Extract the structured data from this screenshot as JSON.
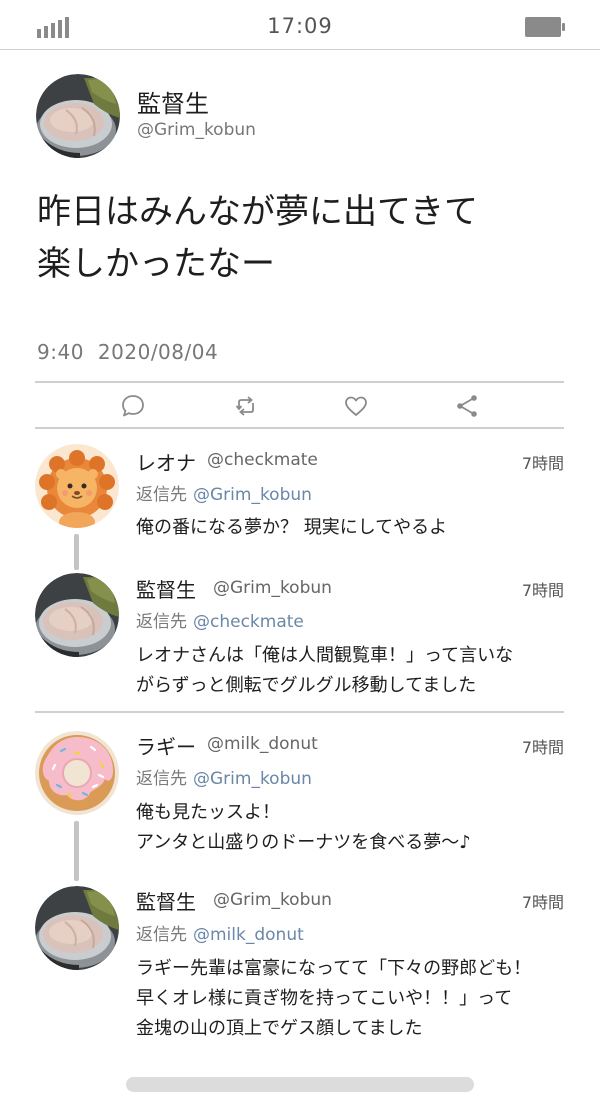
{
  "status_bar": {
    "time": "17:09",
    "signal_icon": "signal-bars-icon",
    "battery_icon": "battery-icon"
  },
  "main_tweet": {
    "display_name": "監督生",
    "handle": "@Grim_kobun",
    "text": "昨日はみんなが夢に出てきて\n楽しかったなー",
    "time": "9:40",
    "date": "2020/08/04",
    "actions": [
      "reply-icon",
      "retweet-icon",
      "like-icon",
      "share-icon"
    ]
  },
  "replies": [
    {
      "display_name": "レオナ",
      "handle": "@checkmate",
      "when": "7時間",
      "reply_prefix": "返信先",
      "reply_to": "@Grim_kobun",
      "text": "俺の番になる夢か？ 現実にしてやるよ",
      "avatar": "lion-avatar"
    },
    {
      "display_name": "監督生",
      "handle": "@Grim_kobun",
      "when": "7時間",
      "reply_prefix": "返信先",
      "reply_to": "@checkmate",
      "text": "レオナさんは「俺は人間観覧車！」って言いな\nがらずっと側転でグルグル移動してました",
      "avatar": "tuna-can-avatar"
    },
    {
      "display_name": "ラギー",
      "handle": "@milk_donut",
      "when": "7時間",
      "reply_prefix": "返信先",
      "reply_to": "@Grim_kobun",
      "text": "俺も見たッスよ！\nアンタと山盛りのドーナツを食べる夢〜♪",
      "avatar": "donut-avatar"
    },
    {
      "display_name": "監督生",
      "handle": "@Grim_kobun",
      "when": "7時間",
      "reply_prefix": "返信先",
      "reply_to": "@milk_donut",
      "text": "ラギー先輩は富豪になってて「下々の野郎ども！\n早くオレ様に貢ぎ物を持ってこいや！！」って\n金塊の山の頂上でゲス顔してました",
      "avatar": "tuna-can-avatar"
    }
  ],
  "colors": {
    "text": "#1e1e1e",
    "muted": "#777777",
    "link": "#6a87a8",
    "divider": "#cfcfcf",
    "icon": "#8a8a8a"
  }
}
